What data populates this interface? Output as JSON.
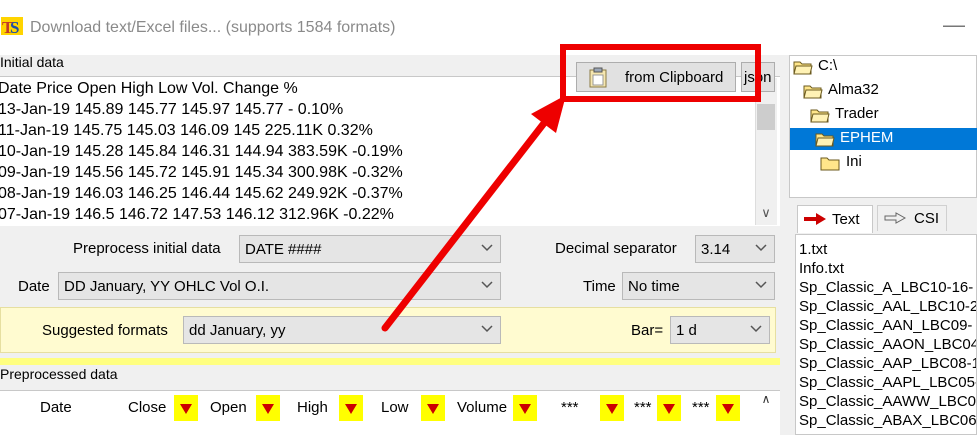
{
  "window": {
    "title": "Download text/Excel files... (supports 1584 formats)",
    "minimize_glyph": "—"
  },
  "initial_data": {
    "label": "Initial data",
    "lines": [
      "Date  Price  Open  High  Low  Vol.  Change %",
      "13-Jan-19  145.89  145.77  145.97  145.77  -  0.10%",
      "11-Jan-19  145.75  145.03  146.09  145  225.11K  0.32%",
      "10-Jan-19  145.28  145.84  146.31  144.94  383.59K  -0.19%",
      "09-Jan-19  145.56  145.72  145.91  145.34  300.98K  -0.32%",
      "08-Jan-19  146.03  146.25  146.44  145.62  249.92K  -0.37%",
      "07-Jan-19  146.5  146.72  147.53  146.12  312.96K  -0.22%"
    ]
  },
  "toolbar": {
    "clipboard_label": "from Clipboard",
    "json_label": "json"
  },
  "preprocess": {
    "label": "Preprocess initial data",
    "value": "DATE ####"
  },
  "decimal": {
    "label": "Decimal separator",
    "value": "3.14"
  },
  "date": {
    "label": "Date",
    "value": "DD January, YY  OHLC Vol O.I."
  },
  "time": {
    "label": "Time",
    "value": "No time"
  },
  "suggested": {
    "label": "Suggested formats",
    "value": "dd January, yy"
  },
  "bar": {
    "label": "Bar=",
    "value": "1 d"
  },
  "preprocessed": {
    "label": "Preprocessed data",
    "columns": [
      "Date",
      "Close",
      "Open",
      "High",
      "Low",
      "Volume",
      "***",
      "***",
      "***"
    ]
  },
  "tree": [
    "C:\\",
    "Alma32",
    "Trader",
    "EPHEM",
    "Ini"
  ],
  "tabs": {
    "text": "Text",
    "csi": "CSI"
  },
  "files": [
    "1.txt",
    "Info.txt",
    "Sp_Classic_A_LBC10-16-",
    "Sp_Classic_AAL_LBC10-2",
    "Sp_Classic_AAN_LBC09-",
    "Sp_Classic_AAON_LBC04",
    "Sp_Classic_AAP_LBC08-1",
    "Sp_Classic_AAPL_LBC05-",
    "Sp_Classic_AAWW_LBC0",
    "Sp_Classic_ABAX_LBC06"
  ],
  "colors": {
    "highlight": "#ee0000",
    "selection": "#0078d7",
    "flag": "#ffff00",
    "band": "#fffbd0"
  }
}
